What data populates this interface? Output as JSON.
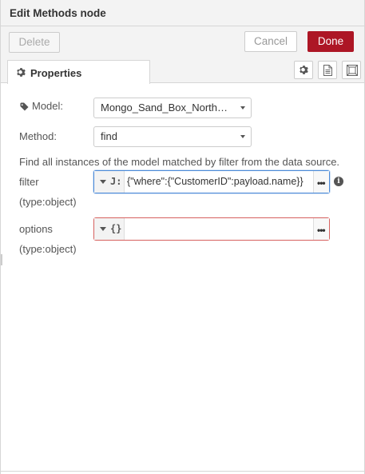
{
  "header": {
    "title": "Edit Methods node"
  },
  "toolbar": {
    "delete_label": "Delete",
    "cancel_label": "Cancel",
    "done_label": "Done"
  },
  "tabs": [
    {
      "label": "Properties",
      "icon": "gear-icon"
    }
  ],
  "tab_buttons": [
    {
      "icon": "gear-icon"
    },
    {
      "icon": "description-icon"
    },
    {
      "icon": "appearance-icon"
    }
  ],
  "form": {
    "model_label": "Model:",
    "model_value": "Mongo_Sand_Box_NorthWi...",
    "method_label": "Method:",
    "method_value": "find",
    "description": "Find all instances of the model matched by filter from the data source.",
    "filter_label": "filter",
    "filter_type_hint": "(type:object)",
    "filter_type_icon": "J:",
    "filter_value": "{\"where\":{\"CustomerID\":payload.name}}",
    "options_label": "options",
    "options_type_hint": "(type:object)",
    "options_type_icon": "{}",
    "options_value": "",
    "expand_glyph": "•••",
    "info_glyph": "i"
  }
}
